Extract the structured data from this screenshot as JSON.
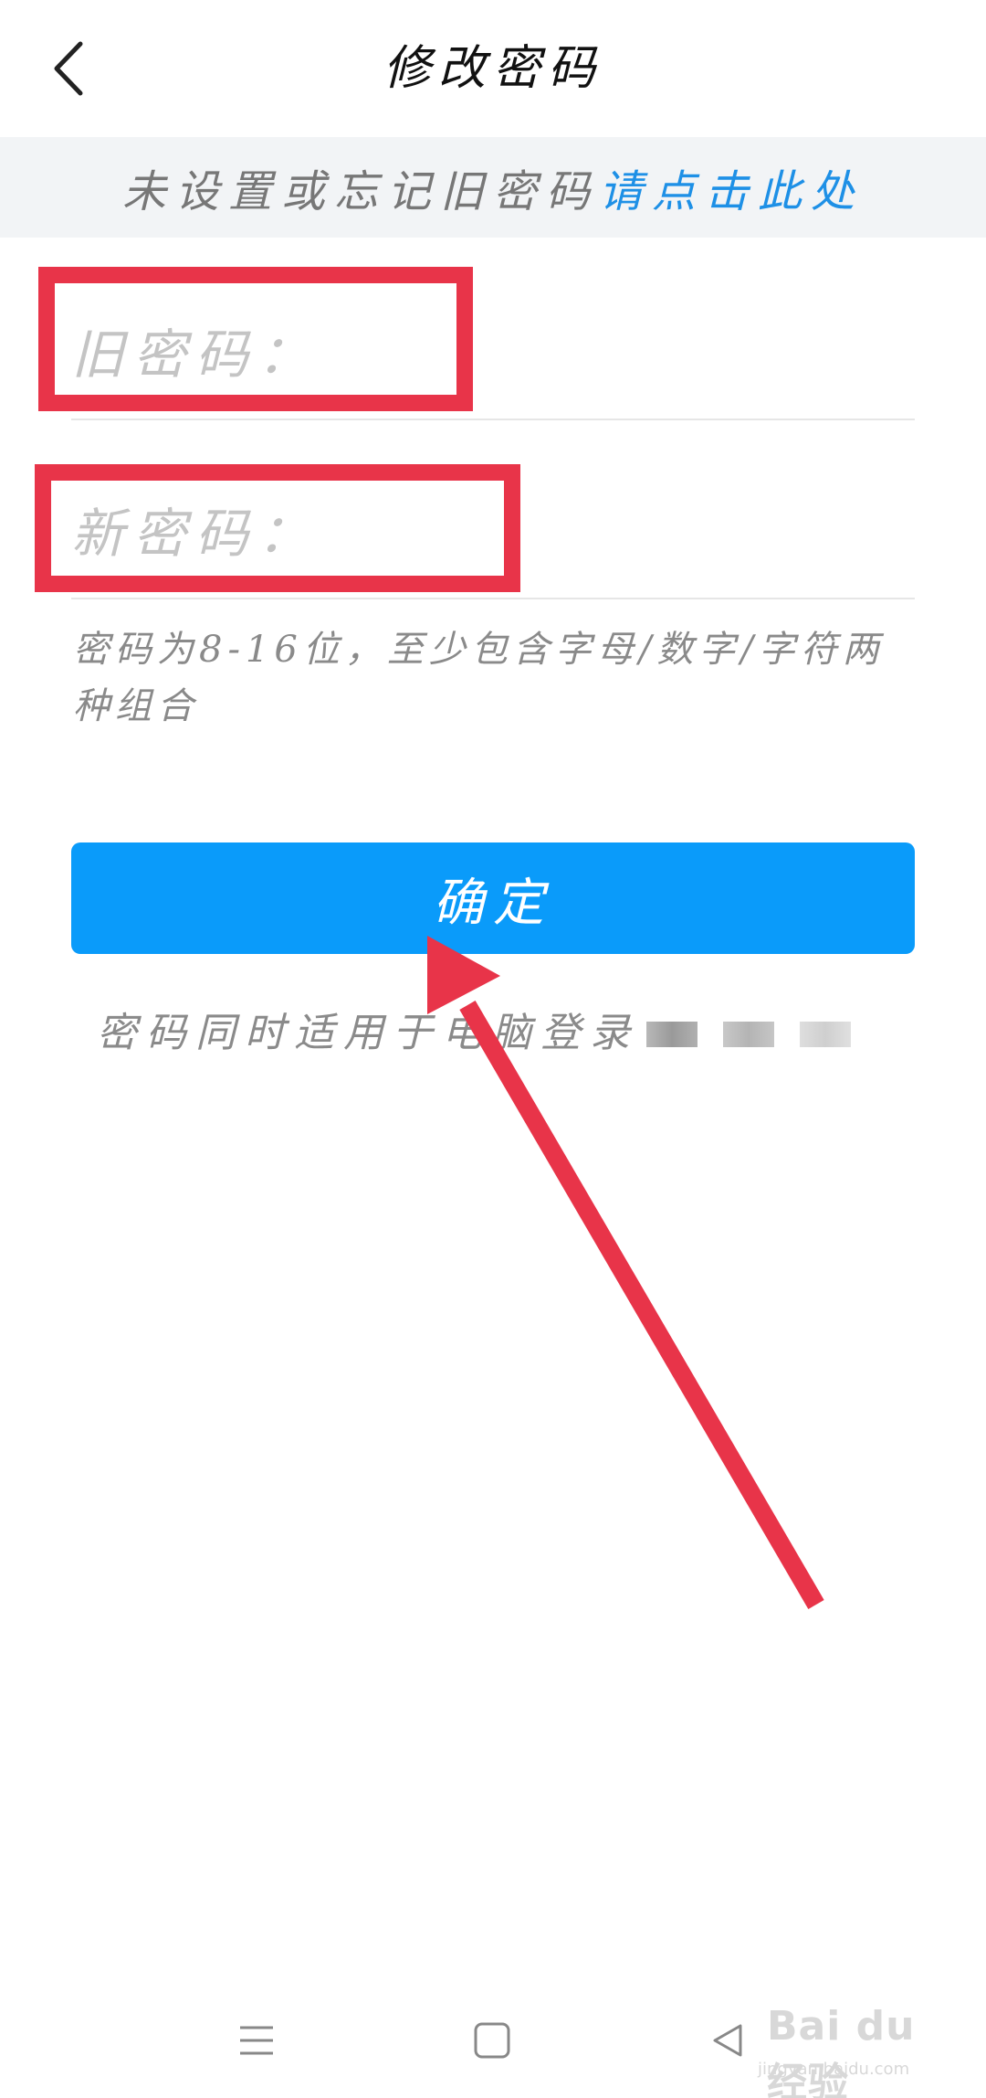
{
  "header": {
    "title": "修改密码",
    "back_icon": "chevron-left-icon"
  },
  "banner": {
    "text": "未设置或忘记旧密码",
    "link": "请点击此处",
    "link_color": "#1e90e6"
  },
  "form": {
    "old_password": {
      "placeholder": "旧密码：",
      "value": ""
    },
    "new_password": {
      "placeholder": "新密码：",
      "value": ""
    },
    "hint": "密码为8-16位，至少包含字母/数字/字符两种组合",
    "confirm_label": "确定",
    "confirm_color": "#0a9bfa"
  },
  "footnote": {
    "text": "密码同时适用于电脑登录"
  },
  "annotation": {
    "highlight_color": "#e83449"
  },
  "navbar": {
    "menu_icon": "menu-icon",
    "home_icon": "square-home-icon",
    "back_icon": "triangle-back-icon"
  },
  "watermark": {
    "main": "Bai du 经验",
    "sub": "jingyan.baidu.com"
  }
}
